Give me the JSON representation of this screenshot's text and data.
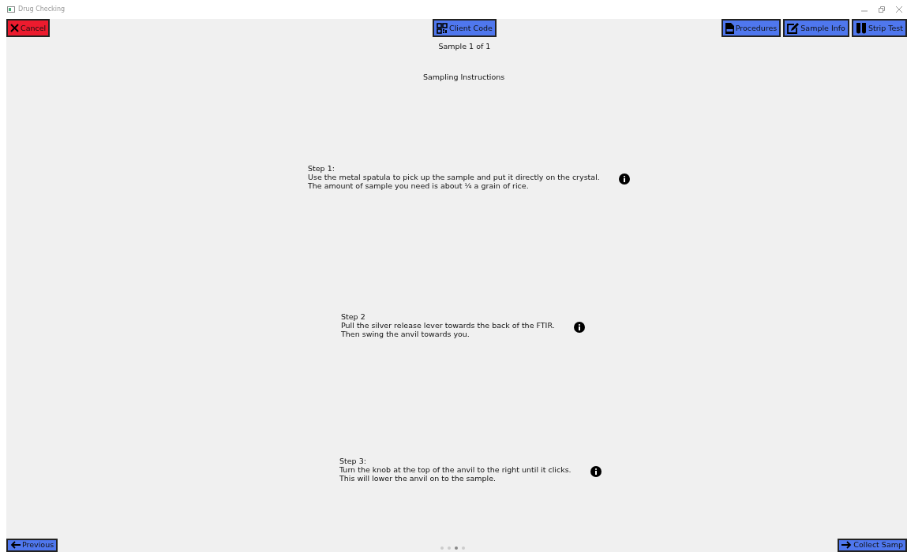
{
  "window": {
    "title": "Drug Checking"
  },
  "toolbar": {
    "cancel": "Cancel",
    "client_code": "Client Code",
    "right_buttons": [
      {
        "kind": "pdf",
        "label": "Procedures"
      },
      {
        "kind": "edit",
        "label": "Sample Info"
      },
      {
        "kind": "tubes",
        "label": "Strip Test"
      }
    ]
  },
  "sample_counter": "Sample 1 of 1",
  "heading": "Sampling Instructions",
  "steps": [
    {
      "title": "Step 1:",
      "lines": [
        "Use the metal spatula to pick up the sample and put it directly on the crystal.",
        "The amount of sample you need is about ¼ a grain of rice."
      ]
    },
    {
      "title": "Step 2",
      "lines": [
        "Pull the silver release lever towards the back of the FTIR.",
        "Then swing the anvil towards you."
      ]
    },
    {
      "title": "Step 3:",
      "lines": [
        "Turn the knob at the top of the anvil to the right until it clicks.",
        "This will lower the anvil on to the sample."
      ]
    }
  ],
  "pages": [
    {
      "selected": false
    },
    {
      "selected": false
    },
    {
      "selected": true
    },
    {
      "selected": false
    }
  ],
  "footer": {
    "previous": "Previous",
    "next": "Collect Samp"
  }
}
